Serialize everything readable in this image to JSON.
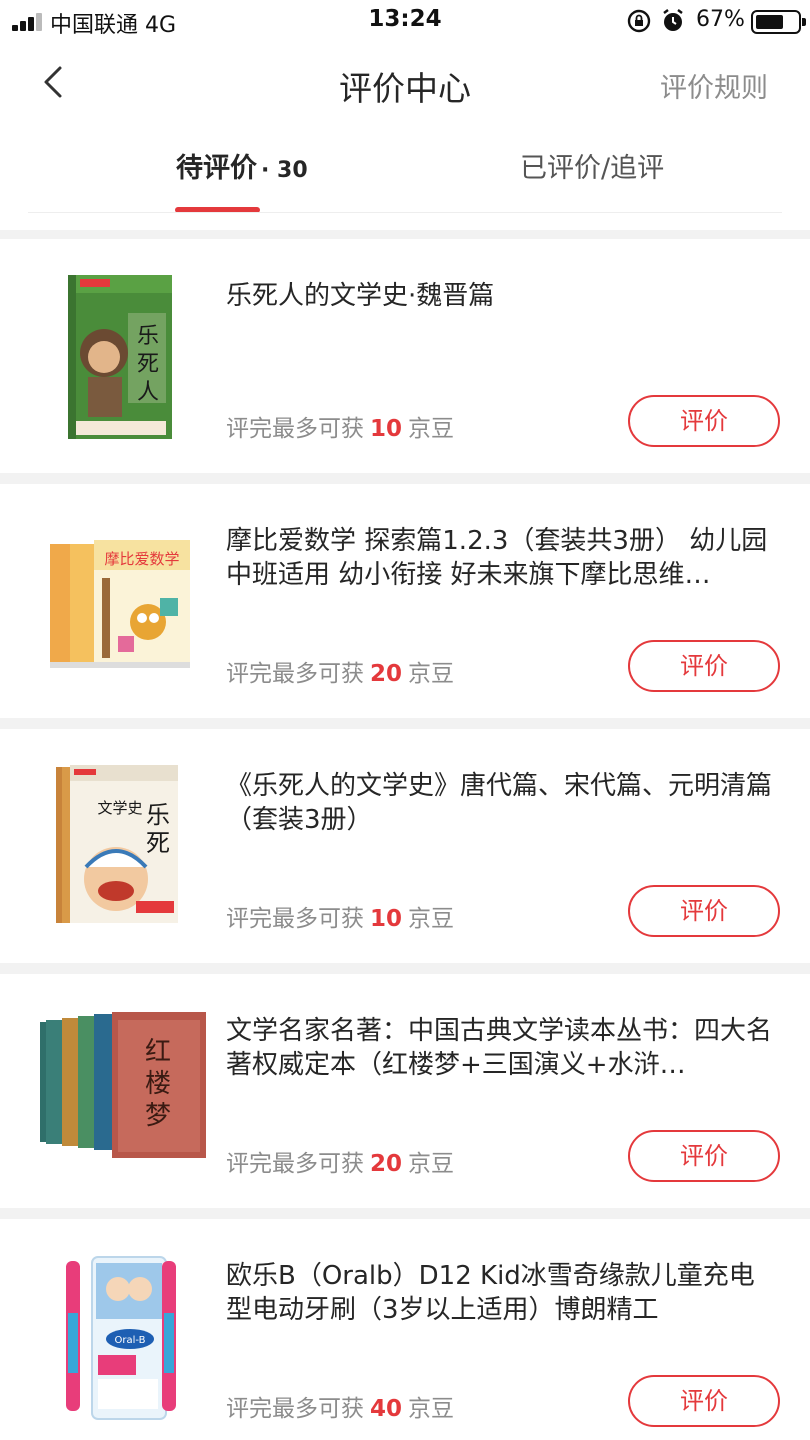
{
  "status_bar": {
    "carrier": "中国联通   4G",
    "time": "13:24",
    "battery": "67%",
    "battery_level": 0.67
  },
  "nav": {
    "title": "评价中心",
    "rules_link": "评价规则"
  },
  "tabs": {
    "pending_label": "待评价",
    "pending_count": "· 30",
    "done_label": "已评价/追评"
  },
  "reward_prefix": "评完最多可获",
  "reward_suffix": "京豆",
  "button_label": "评价",
  "items": [
    {
      "name": "乐死人的文学史·魏晋篇",
      "beans": "10"
    },
    {
      "name": "摩比爱数学 探索篇1.2.3（套装共3册） 幼儿园中班适用 幼小衔接 好未来旗下摩比思维…",
      "beans": "20"
    },
    {
      "name": "《乐死人的文学史》唐代篇、宋代篇、元明清篇（套装3册）",
      "beans": "10"
    },
    {
      "name": "文学名家名著：中国古典文学读本丛书：四大名著权威定本（红楼梦+三国演义+水浒…",
      "beans": "20"
    },
    {
      "name": "欧乐B（Oralb）D12 Kid冰雪奇缘款儿童充电型电动牙刷（3岁以上适用）博朗精工",
      "beans": "40"
    }
  ],
  "colors": {
    "accent": "#e4393c",
    "muted_text": "#8c8c8c",
    "background": "#f2f2f2"
  }
}
